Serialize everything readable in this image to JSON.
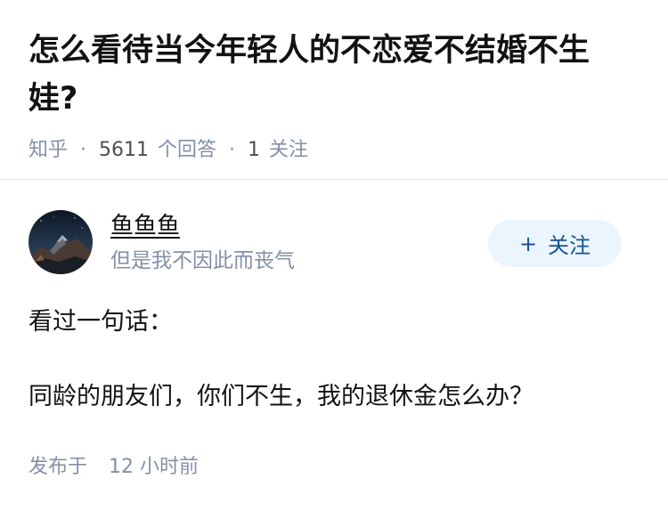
{
  "question": {
    "title": "怎么看待当今年轻人的不恋爱不结婚不生娃?",
    "source": "知乎",
    "answer_count": "5611",
    "answer_label": "个回答",
    "follower_count": "1",
    "follower_label": "关注",
    "separator": "·"
  },
  "author": {
    "name": "鱼鱼鱼",
    "bio": "但是我不因此而丧气",
    "avatar_icon": "mountain-night-avatar"
  },
  "follow_button": {
    "icon": "+",
    "label": "关注"
  },
  "answer": {
    "paragraphs": [
      "看过一句话：",
      "同龄的朋友们，你们不生，我的退休金怎么办？"
    ],
    "publish_label": "发布于",
    "publish_time": "12 小时前"
  },
  "colors": {
    "title": "#121212",
    "meta": "#8590a6",
    "follow_bg": "#ebf5fd",
    "follow_text": "#175199"
  }
}
